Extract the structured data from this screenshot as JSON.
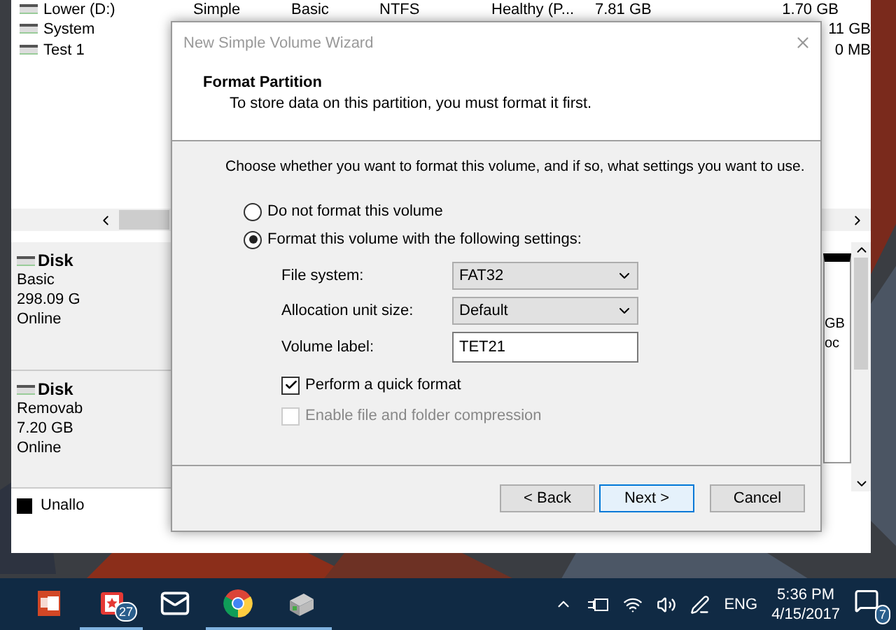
{
  "disk_management": {
    "volumes": [
      {
        "name": "Lower (D:)",
        "layout": "Simple",
        "type": "Basic",
        "file_system": "NTFS",
        "status": "Healthy (P...",
        "capacity": "7.81 GB",
        "free_space": "1.70 GB"
      },
      {
        "name": "System",
        "free_space": "11 GB"
      },
      {
        "name": "Test 1",
        "free_space": "0 MB"
      }
    ],
    "disks": [
      {
        "name": "Disk",
        "type": "Basic",
        "size": "298.09 G",
        "status": "Online"
      },
      {
        "name": "Disk",
        "type": "Removab",
        "size": "7.20 GB",
        "status": "Online"
      }
    ],
    "partition_fragments": [
      "GB",
      "oc"
    ],
    "legend": {
      "label": "Unallo"
    }
  },
  "dialog": {
    "title": "New Simple Volume Wizard",
    "heading": "Format Partition",
    "subheading": "To store data on this partition, you must format it first.",
    "instruction": "Choose whether you want to format this volume, and if so, what settings you want to use.",
    "options": [
      {
        "label": "Do not format this volume",
        "selected": false
      },
      {
        "label": "Format this volume with the following settings:",
        "selected": true
      }
    ],
    "fields": [
      {
        "kind": "select",
        "label": "File system:",
        "value": "FAT32"
      },
      {
        "kind": "select",
        "label": "Allocation unit size:",
        "value": "Default"
      },
      {
        "kind": "text",
        "label": "Volume label:",
        "value": "TET21"
      }
    ],
    "checkboxes": [
      {
        "label": "Perform a quick format",
        "checked": true,
        "disabled": false
      },
      {
        "label": "Enable file and folder compression",
        "checked": false,
        "disabled": true
      }
    ],
    "buttons": [
      {
        "label": "< Back",
        "default": false
      },
      {
        "label": "Next >",
        "default": true
      },
      {
        "label": "Cancel",
        "default": false
      }
    ]
  },
  "taskbar": {
    "apps": [
      {
        "kind": "presentation",
        "running": false
      },
      {
        "kind": "reader",
        "badge": "27",
        "running": true
      },
      {
        "kind": "mail",
        "running": false
      },
      {
        "kind": "browser",
        "running": true
      },
      {
        "kind": "drive",
        "running": true
      }
    ],
    "language": "ENG",
    "time": "5:36 PM",
    "date": "4/15/2017",
    "notification_count": "7"
  }
}
